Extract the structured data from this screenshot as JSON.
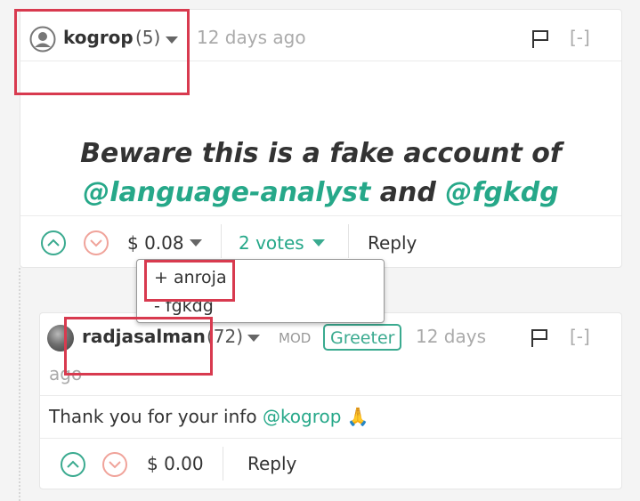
{
  "comment1": {
    "username": "kogrop",
    "reputation": "(5)",
    "time": "12 days ago",
    "collapse": "[-]",
    "body_line1": "Beware this is a fake account of",
    "mention1": "@language-analyst",
    "and_word": "and",
    "mention2": "@fgkdg",
    "payout": "$ 0.08",
    "votes": "2 votes",
    "reply": "Reply"
  },
  "votes_popup": {
    "items": [
      "+ anroja",
      "- fgkdg"
    ]
  },
  "comment2": {
    "username": "radjasalman",
    "reputation": "(72)",
    "mod_label": "MOD",
    "badge": "Greeter",
    "time_part1": "12 days",
    "time_part2": "ago",
    "collapse": "[-]",
    "body_text": "Thank you for your info",
    "mention": "@kogrop",
    "emoji": "🙏",
    "payout": "$ 0.00",
    "reply": "Reply"
  },
  "colors": {
    "accent": "#26a889",
    "downvote": "#f0a39a",
    "highlight_box": "#d83a4f"
  },
  "icons": [
    "avatar-icon",
    "flag-icon",
    "upvote-icon",
    "downvote-icon",
    "chevron-down-icon"
  ]
}
